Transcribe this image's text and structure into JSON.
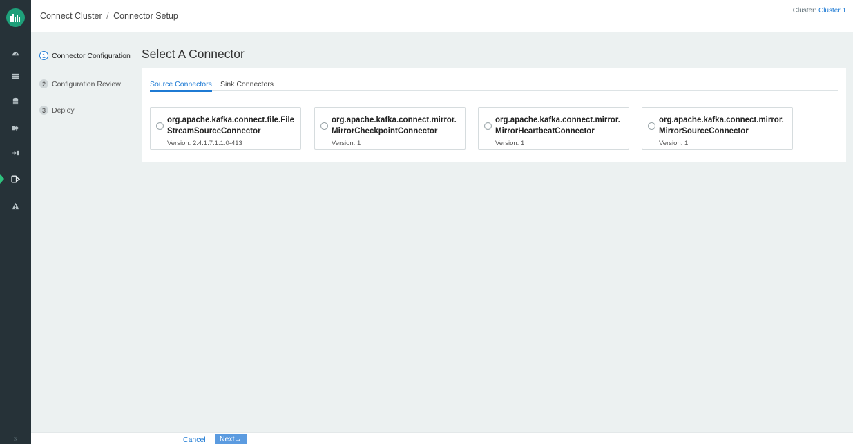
{
  "header": {
    "breadcrumb_root": "Connect Cluster",
    "breadcrumb_separator": "/",
    "breadcrumb_current": "Connector Setup",
    "cluster_prefix": "Cluster:",
    "cluster_name": "Cluster 1"
  },
  "rail": {
    "icons": [
      "logo-icon",
      "dashboard-icon",
      "list-icon",
      "database-icon",
      "export-icon",
      "import-icon",
      "connect-icon",
      "alert-icon",
      "expand-icon"
    ],
    "active_index": 6,
    "expand_glyph": "»"
  },
  "steps": [
    {
      "number": "1",
      "label": "Connector Configuration",
      "active": true
    },
    {
      "number": "2",
      "label": "Configuration Review",
      "active": false
    },
    {
      "number": "3",
      "label": "Deploy",
      "active": false
    }
  ],
  "main": {
    "title": "Select A Connector",
    "tabs": [
      {
        "label": "Source Connectors",
        "active": true
      },
      {
        "label": "Sink Connectors",
        "active": false
      }
    ],
    "connectors": [
      {
        "name": "org.apache.kafka.connect.file.FileStreamSourceConnector",
        "version": "Version: 2.4.1.7.1.1.0-413",
        "selected": false
      },
      {
        "name": "org.apache.kafka.connect.mirror.MirrorCheckpointConnector",
        "version": "Version: 1",
        "selected": false
      },
      {
        "name": "org.apache.kafka.connect.mirror.MirrorHeartbeatConnector",
        "version": "Version: 1",
        "selected": false
      },
      {
        "name": "org.apache.kafka.connect.mirror.MirrorSourceConnector",
        "version": "Version: 1",
        "selected": false
      }
    ]
  },
  "footer": {
    "cancel_label": "Cancel",
    "next_label": "Next→"
  },
  "colors": {
    "rail": "#263238",
    "accent": "#1f7bd4",
    "logo": "#1ea07a",
    "active_marker": "#2ec27e",
    "next_button": "#5b9be0",
    "background": "#ecf1f1"
  }
}
